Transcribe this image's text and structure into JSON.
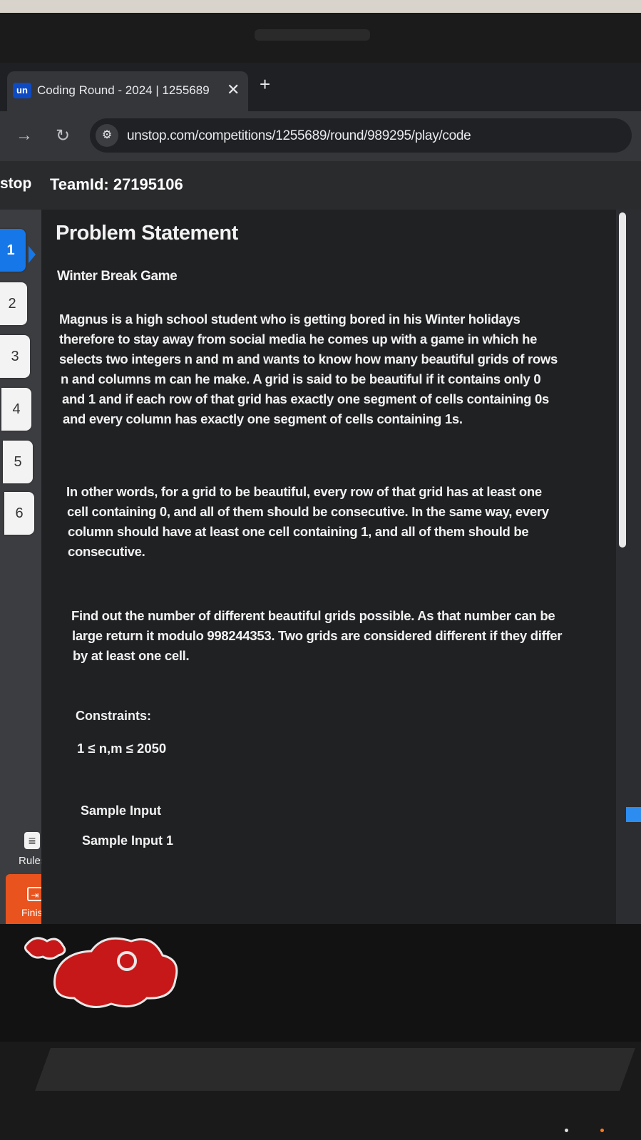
{
  "browser": {
    "tab": {
      "favicon_text": "un",
      "title": "Coding Round - 2024 | 1255689",
      "close_glyph": "✕"
    },
    "new_tab_glyph": "+",
    "url": "unstop.com/competitions/1255689/round/989295/play/code"
  },
  "header": {
    "brand_fragment": "stop",
    "team_id": "TeamId: 27195106"
  },
  "sidebar": {
    "questions": [
      "1",
      "2",
      "3",
      "4",
      "5",
      "6"
    ],
    "active_question": "1",
    "rules_label": "Rules",
    "finish_label": "Finish"
  },
  "problem": {
    "heading": "Problem Statement",
    "title": "Winter Break Game",
    "para1": [
      "Magnus is a high school student who is getting bored in his Winter holidays",
      "therefore to stay away from social media he comes up with a game in which he",
      "selects two integers n and m and wants to know how many beautiful grids of rows",
      "n and columns m can he make. A grid is said to be beautiful if it contains only 0",
      "and 1 and if each row of that grid has exactly one segment of cells containing 0s",
      "and every column has exactly one segment of cells containing 1s."
    ],
    "para2": [
      "In other words, for a grid to be beautiful, every row of that grid has at least one",
      "cell containing 0, and all of them should be consecutive. In the same way, every",
      "column should have at least one cell containing 1, and all of them should be",
      "consecutive."
    ],
    "para3": [
      "Find out the number of different beautiful grids possible. As that number can be",
      "large return it modulo 998244353. Two grids are considered different if they differ",
      "by at least one cell."
    ],
    "constraints_label": "Constraints:",
    "constraints": "1 ≤ n,m ≤ 2050",
    "sample_input_label": "Sample Input",
    "sample_input_1_label": "Sample Input 1"
  },
  "colors": {
    "accent": "#1677e8",
    "finish": "#e8531e",
    "panel_bg": "#202123"
  }
}
